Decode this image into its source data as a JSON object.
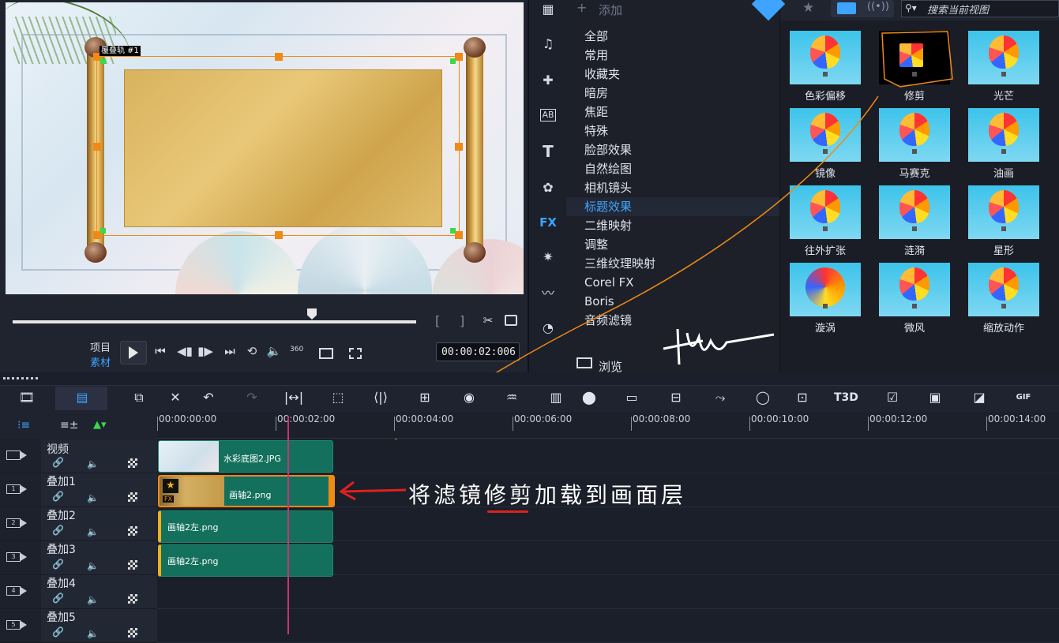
{
  "preview": {
    "selection_tag": "覆叠轨 #1",
    "mode_project": "项目",
    "mode_clip": "素材",
    "timecode": "00:00:02:006",
    "badge_360": "360"
  },
  "library": {
    "add_label": "添加",
    "search_placeholder": "搜索当前视图",
    "browse_label": "浏览",
    "categories": [
      "全部",
      "常用",
      "收藏夹",
      "暗房",
      "焦距",
      "特殊",
      "脸部效果",
      "自然绘图",
      "相机镜头",
      "标题效果",
      "二维映射",
      "调整",
      "三维纹理映射",
      "Corel FX",
      "Boris",
      "音频滤镜"
    ],
    "selected_category": "标题效果",
    "fx_tab": "FX",
    "filters": [
      "色彩偏移",
      "修剪",
      "光芒",
      "镜像",
      "马赛克",
      "油画",
      "往外扩张",
      "涟漪",
      "星形",
      "漩涡",
      "微风",
      "缩放动作"
    ]
  },
  "timeline": {
    "ruler": [
      "00:00:00:00",
      "00:00:02:00",
      "00:00:04:00",
      "00:00:06:00",
      "00:00:08:00",
      "00:00:10:00",
      "00:00:12:00",
      "00:00:14:00"
    ],
    "tracks": [
      {
        "name": "视频",
        "num": ""
      },
      {
        "name": "叠加1",
        "num": "1"
      },
      {
        "name": "叠加2",
        "num": "2"
      },
      {
        "name": "叠加3",
        "num": "3"
      },
      {
        "name": "叠加4",
        "num": "4"
      },
      {
        "name": "叠加5",
        "num": "5"
      }
    ],
    "clips": {
      "video": "水彩底图2.JPG",
      "overlay1": "画轴2.png",
      "overlay2": "画轴2左.png",
      "overlay3": "画轴2左.png"
    },
    "gif_label": "GIF",
    "t3d_label": "T3D",
    "fx_badge": "FX"
  },
  "annotation": {
    "text_before": "将滤镜",
    "text_highlight": "修剪",
    "text_after": "加载到画面层"
  },
  "colors": {
    "accent_orange": "#f08a14",
    "accent_blue": "#3ea4ff",
    "clip_green": "#13705c",
    "playhead": "#c8327a",
    "annotation_red": "#e02020"
  }
}
